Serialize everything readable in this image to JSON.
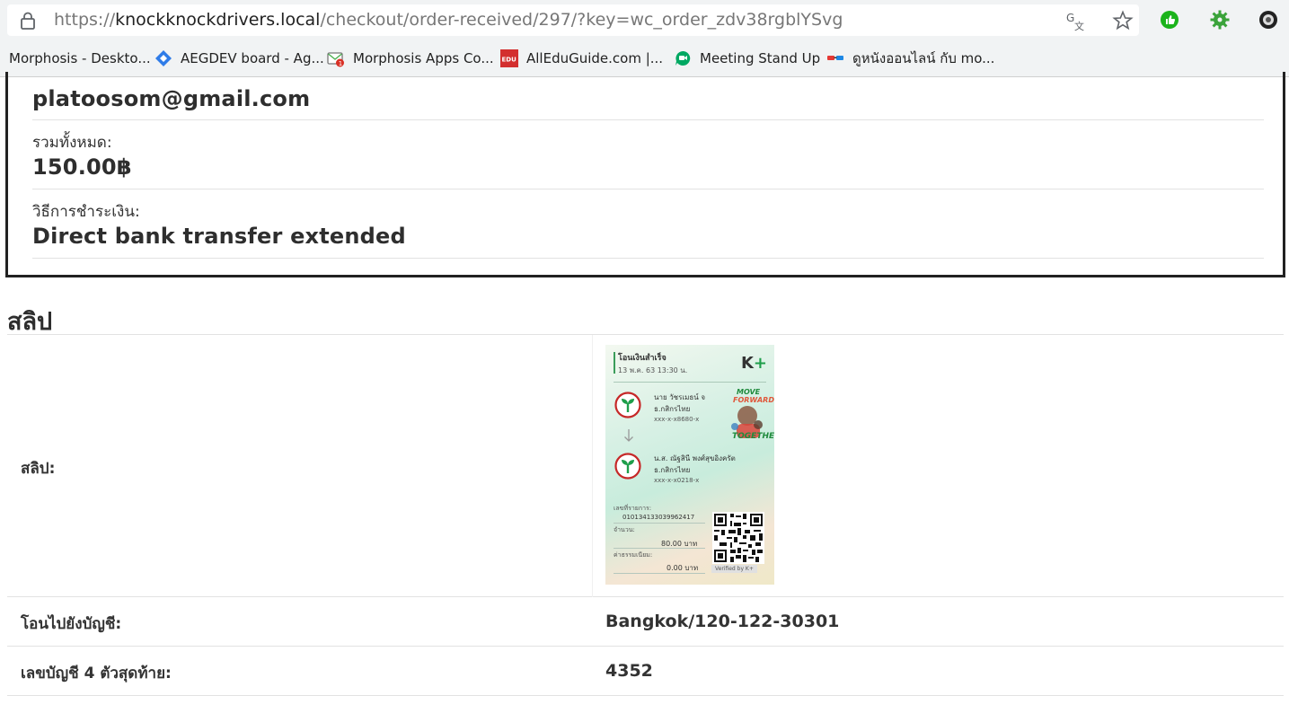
{
  "browser": {
    "url_scheme": "https://",
    "url_host": "knockknockdrivers.local",
    "url_path": "/checkout/order-received/297/?key=wc_order_zdv38rgblYSvg",
    "icons": [
      "lock-icon",
      "translate-icon",
      "star-icon",
      "extension-thumb-icon",
      "extension-gear-icon",
      "extension-circle-icon"
    ],
    "bookmarks": [
      {
        "label": "Morphosis - Deskto...",
        "icon": "none"
      },
      {
        "label": "AEGDEV board - Ag...",
        "icon": "diamond-icon"
      },
      {
        "label": "Morphosis Apps Co...",
        "icon": "mail-icon"
      },
      {
        "label": "AllEduGuide.com |...",
        "icon": "edu-icon"
      },
      {
        "label": "Meeting Stand Up",
        "icon": "meet-icon"
      },
      {
        "label": "ดูหนังออนไลน์ กับ mo...",
        "icon": "glasses-icon"
      }
    ]
  },
  "order": {
    "email": "platoosom@gmail.com",
    "total_label": "รวมทั้งหมด:",
    "total_value": "150.00฿",
    "payment_label": "วิธีการชำระเงิน:",
    "payment_value": "Direct bank transfer extended"
  },
  "slip_section": {
    "heading": "สลิป",
    "slip_label": "สลิป:",
    "transfer_to_label": "โอนไปยังบัญชี:",
    "transfer_to_value": "Bangkok/120-122-30301",
    "last4_label": "เลขบัญชี 4 ตัวสุดท้าย:",
    "last4_value": "4352"
  },
  "slip_image": {
    "title": "โอนเงินสำเร็จ",
    "date": "13 พ.ค. 63  13:30 น.",
    "brand": "K",
    "brand_plus": "+",
    "sender_name": "นาย วัชรเมธน์ จ",
    "sender_bank": "ธ.กสิกรไทย",
    "sender_account": "xxx-x-x8680-x",
    "receiver_name": "น.ส. ณัฐสินี พงศ์สุขอิงครัต",
    "receiver_bank": "ธ.กสิกรไทย",
    "receiver_account": "xxx-x-x0218-x",
    "ref_label": "เลขที่รายการ:",
    "ref_value": "010134133039962417",
    "amount_label": "จำนวน:",
    "amount_value": "80.00 บาท",
    "fee_label": "ค่าธรรมเนียม:",
    "fee_value": "0.00 บาท",
    "verified": "Verified by K+",
    "poster_move": "MOVE",
    "poster_forward": "FORWARD",
    "poster_together": "TOGETHER",
    "accent_color": "#1e9e4a"
  }
}
